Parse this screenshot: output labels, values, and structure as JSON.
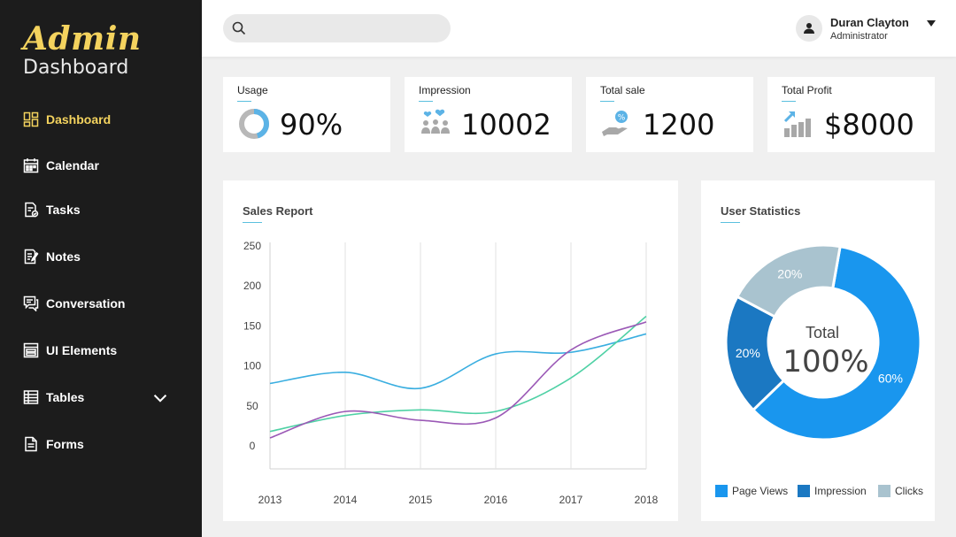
{
  "sidebar": {
    "brand_title": "Admin",
    "brand_subtitle": "Dashboard",
    "items": [
      {
        "label": "Dashboard",
        "icon": "dashboard-icon"
      },
      {
        "label": "Calendar",
        "icon": "calendar-icon"
      },
      {
        "label": "Tasks",
        "icon": "tasks-icon"
      },
      {
        "label": "Notes",
        "icon": "notes-icon"
      },
      {
        "label": "Conversation",
        "icon": "conversation-icon"
      },
      {
        "label": "UI Elements",
        "icon": "ui-elements-icon"
      },
      {
        "label": "Tables",
        "icon": "tables-icon"
      },
      {
        "label": "Forms",
        "icon": "forms-icon"
      }
    ],
    "active_color": "#f4d35e"
  },
  "topbar": {
    "search_placeholder": "",
    "user_name": "Duran Clayton",
    "user_role": "Administrator"
  },
  "cards": [
    {
      "label": "Usage",
      "value": "90%",
      "icon": "donut-gauge-icon"
    },
    {
      "label": "Impression",
      "value": "10002",
      "icon": "users-hearts-icon"
    },
    {
      "label": "Total sale",
      "value": "1200",
      "icon": "hand-coin-icon"
    },
    {
      "label": "Total Profit",
      "value": "$8000",
      "icon": "bar-growth-icon"
    }
  ],
  "sales_report": {
    "title": "Sales Report"
  },
  "user_statistics": {
    "title": "User Statistics",
    "center_label": "Total",
    "center_value": "100%",
    "legend": [
      {
        "label": "Page Views",
        "color": "#1996ee"
      },
      {
        "label": "Impression",
        "color": "#1b78c2"
      },
      {
        "label": "Clicks",
        "color": "#a9c3cf"
      }
    ]
  },
  "chart_data": [
    {
      "type": "line",
      "title": "Sales Report",
      "x": [
        "2013",
        "2014",
        "2015",
        "2016",
        "2017",
        "2018"
      ],
      "ylim": [
        0,
        250
      ],
      "yticks": [
        "0",
        "50",
        "100",
        "150",
        "200",
        "250"
      ],
      "grid": "vertical",
      "series": [
        {
          "color": "#3aaee0",
          "values": [
            78,
            92,
            72,
            115,
            117,
            140
          ]
        },
        {
          "color": "#4fd1a5",
          "values": [
            18,
            38,
            45,
            43,
            85,
            162
          ]
        },
        {
          "color": "#9b59b6",
          "values": [
            10,
            43,
            32,
            35,
            120,
            155
          ]
        }
      ]
    },
    {
      "type": "pie",
      "title": "User Statistics",
      "slices": [
        {
          "label": "Page Views",
          "value": 60,
          "text": "60%",
          "color": "#1996ee"
        },
        {
          "label": "Impression",
          "value": 20,
          "text": "20%",
          "color": "#1b78c2"
        },
        {
          "label": "Clicks",
          "value": 20,
          "text": "20%",
          "color": "#a9c3cf"
        }
      ]
    }
  ]
}
